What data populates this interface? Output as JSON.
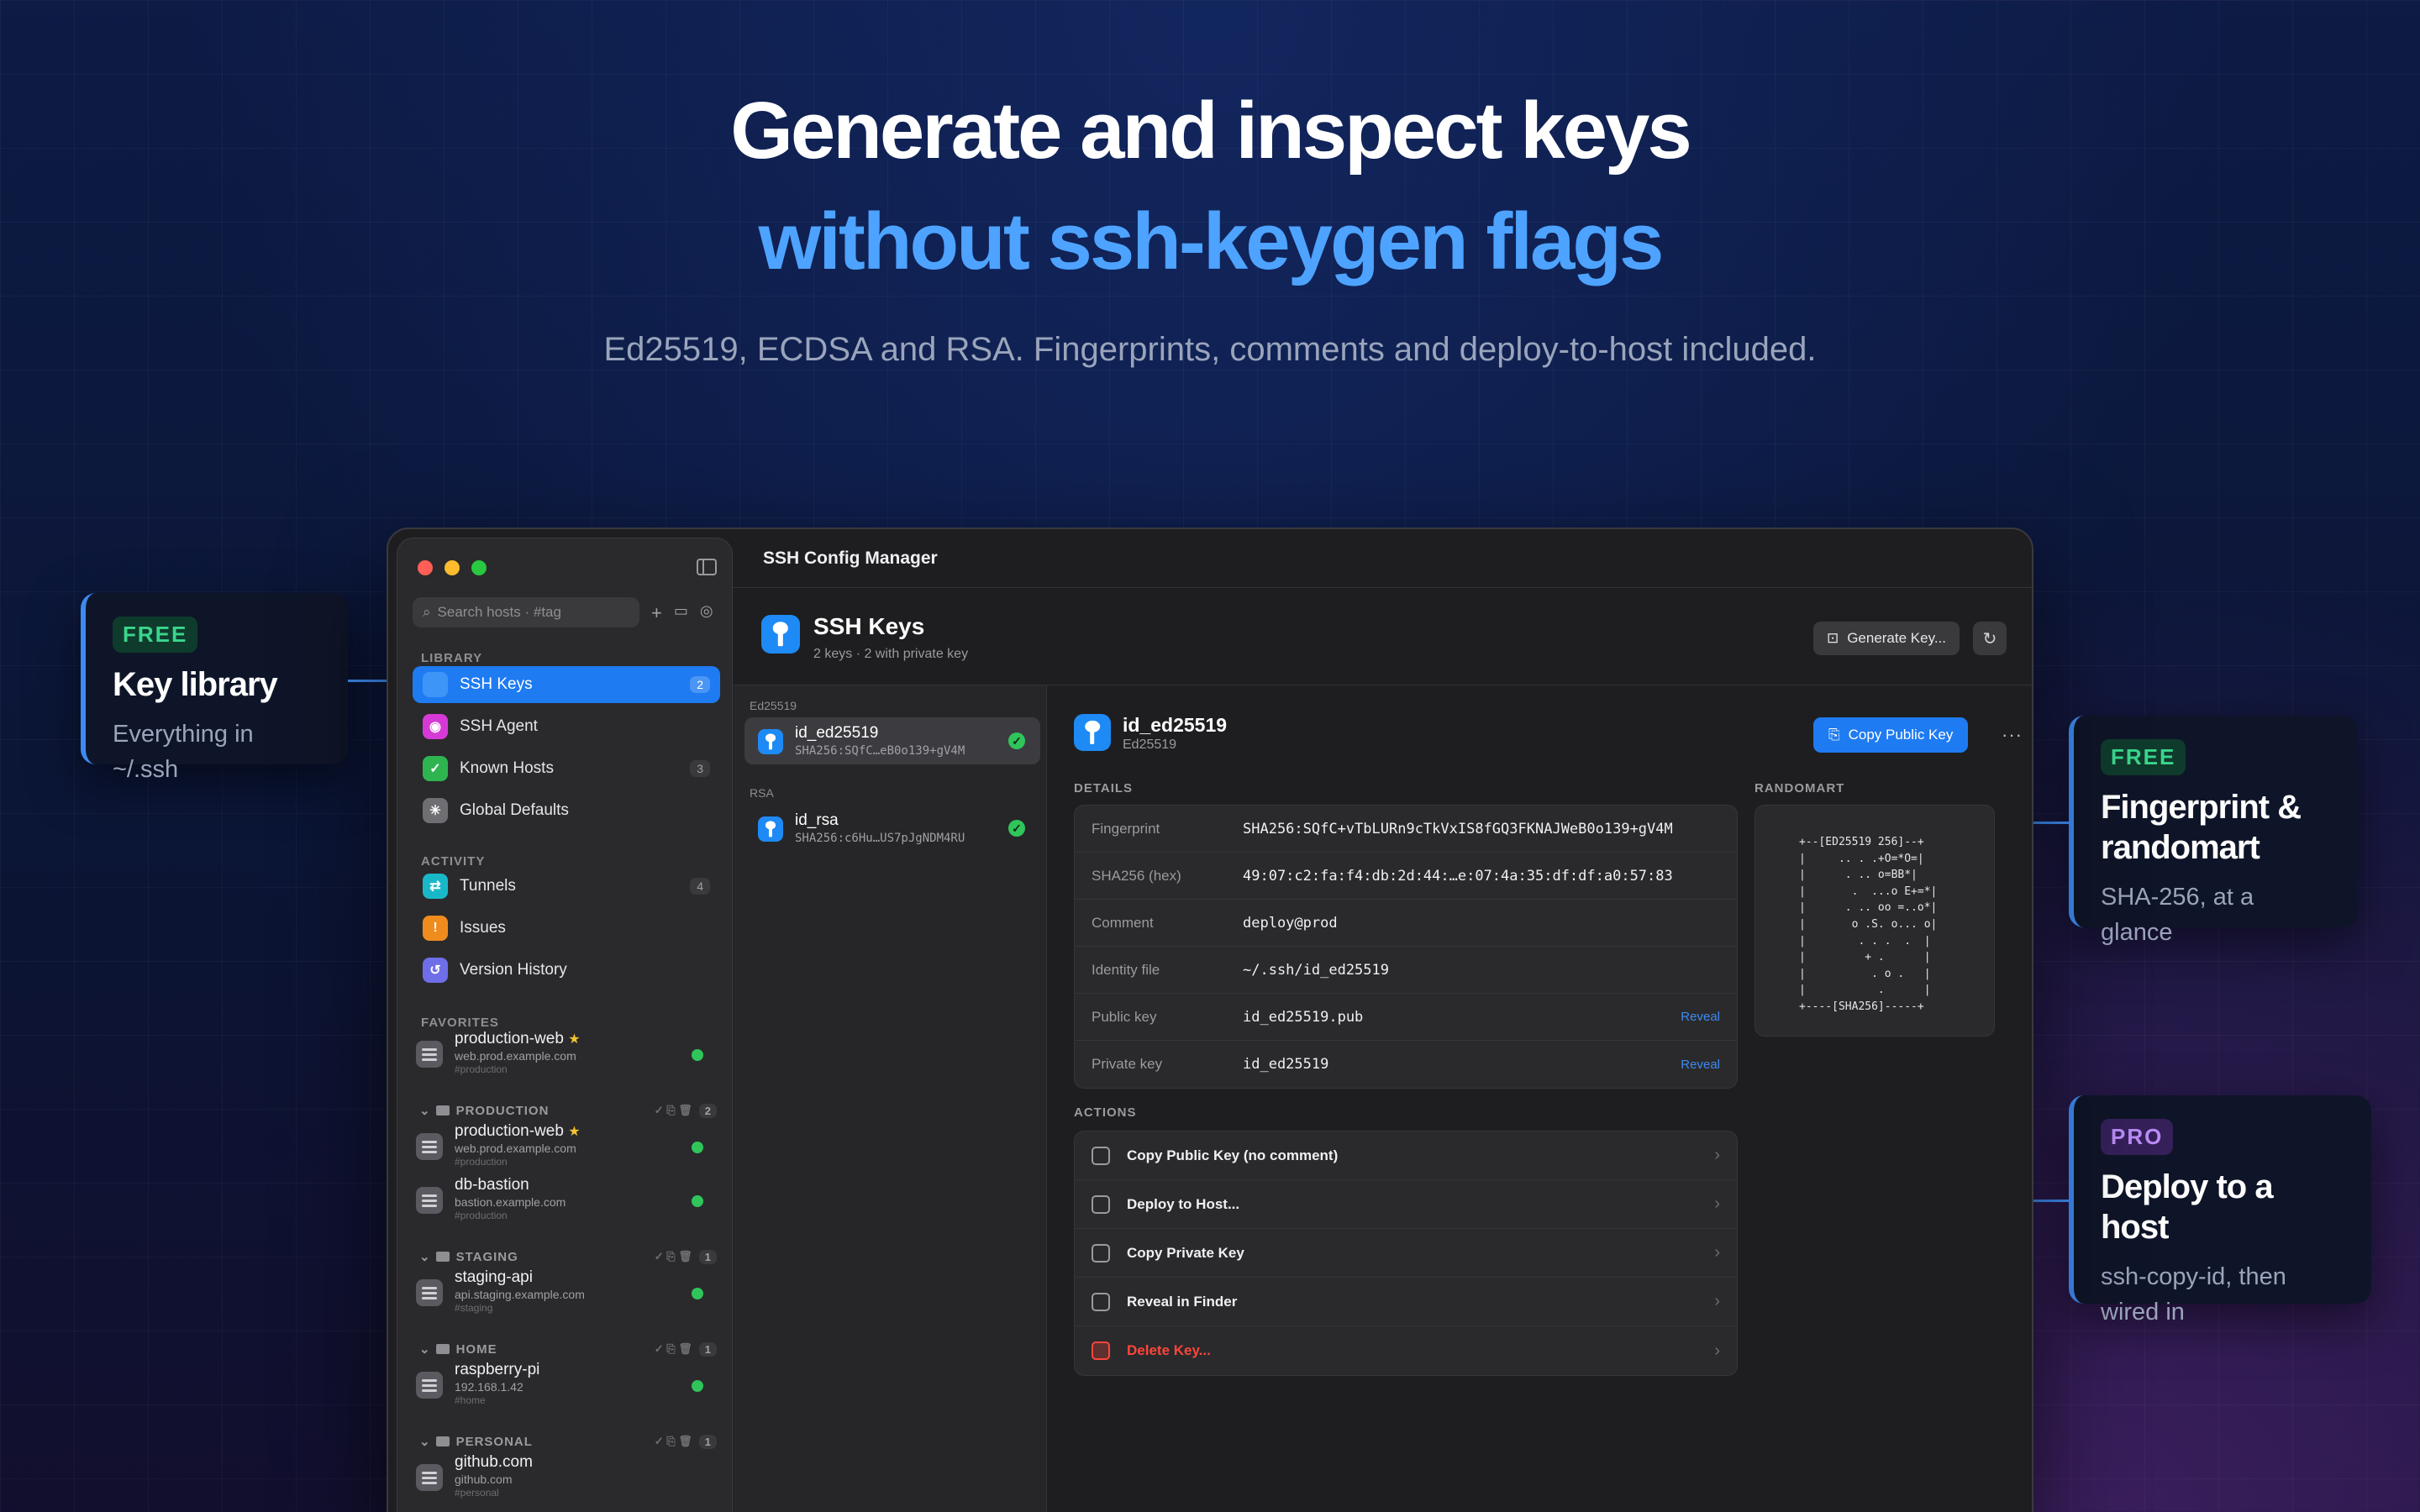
{
  "hero": {
    "title": "Generate and inspect keys",
    "highlight": "without ssh-keygen flags",
    "subtitle": "Ed25519, ECDSA and RSA. Fingerprints, comments and deploy-to-host included."
  },
  "callouts": {
    "left": {
      "badge": "FREE",
      "title": "Key library",
      "subtitle": "Everything in ~/.ssh"
    },
    "right_top": {
      "badge": "FREE",
      "title_line1": "Fingerprint &",
      "title_line2": "randomart",
      "subtitle": "SHA-256, at a glance"
    },
    "right_bottom": {
      "badge": "PRO",
      "title": "Deploy to a host",
      "subtitle_line1": "ssh-copy-id, then",
      "subtitle_line2": "wired in"
    }
  },
  "window": {
    "title": "SSH Config Manager"
  },
  "sidebar": {
    "search_placeholder": "Search hosts · #tag",
    "library_label": "LIBRARY",
    "library": [
      {
        "label": "SSH Keys",
        "count": "2",
        "icon": "key-icon",
        "color": "#1e8af5"
      },
      {
        "label": "SSH Agent",
        "count": "",
        "icon": "agent-icon",
        "color": "#d63ad6"
      },
      {
        "label": "Known Hosts",
        "count": "3",
        "icon": "shield-icon",
        "color": "#2fb550"
      },
      {
        "label": "Global Defaults",
        "count": "",
        "icon": "asterisk-icon",
        "color": "#6e6e73"
      }
    ],
    "activity_label": "ACTIVITY",
    "activity": [
      {
        "label": "Tunnels",
        "count": "4",
        "icon": "tunnel-icon",
        "color": "#19b8c9"
      },
      {
        "label": "Issues",
        "count": "",
        "icon": "warning-icon",
        "color": "#f08c1e"
      },
      {
        "label": "Version History",
        "count": "",
        "icon": "history-icon",
        "color": "#6e6ee8"
      }
    ],
    "favorites_label": "FAVORITES",
    "favorites": [
      {
        "name": "production-web",
        "star": "★",
        "addr": "web.prod.example.com",
        "tag": "#production"
      }
    ],
    "groups": [
      {
        "label": "PRODUCTION",
        "tools": "✓ ⎘ 🗑",
        "count": "2",
        "hosts": [
          {
            "name": "production-web",
            "star": "★",
            "addr": "web.prod.example.com",
            "tag": "#production"
          },
          {
            "name": "db-bastion",
            "star": "",
            "addr": "bastion.example.com",
            "tag": "#production"
          }
        ]
      },
      {
        "label": "STAGING",
        "tools": "✓ ⎘ 🗑",
        "count": "1",
        "hosts": [
          {
            "name": "staging-api",
            "star": "",
            "addr": "api.staging.example.com",
            "tag": "#staging"
          }
        ]
      },
      {
        "label": "HOME",
        "tools": "✓ ⎘ 🗑",
        "count": "1",
        "hosts": [
          {
            "name": "raspberry-pi",
            "star": "",
            "addr": "192.168.1.42",
            "tag": "#home"
          }
        ]
      },
      {
        "label": "PERSONAL",
        "tools": "✓ ⎘ 🗑",
        "count": "1",
        "hosts": [
          {
            "name": "github.com",
            "star": "",
            "addr": "github.com",
            "tag": "#personal"
          }
        ]
      }
    ]
  },
  "page": {
    "title": "SSH Keys",
    "subtitle": "2 keys · 2 with private key",
    "generate_label": "Generate Key...",
    "refresh_icon": "refresh-icon"
  },
  "key_list": {
    "sections": [
      {
        "label": "Ed25519",
        "keys": [
          {
            "name": "id_ed25519",
            "fp": "SHA256:SQfC…eB0o139+gV4M"
          }
        ]
      },
      {
        "label": "RSA",
        "keys": [
          {
            "name": "id_rsa",
            "fp": "SHA256:c6Hu…US7pJgNDM4RU"
          }
        ]
      }
    ]
  },
  "detail": {
    "name": "id_ed25519",
    "type": "Ed25519",
    "copy_label": "Copy Public Key",
    "more": "···",
    "details_label": "DETAILS",
    "rows": [
      {
        "key": "Fingerprint",
        "value": "SHA256:SQfC+vTbLURn9cTkVxIS8fGQ3FKNAJWeB0o139+gV4M",
        "action": ""
      },
      {
        "key": "SHA256 (hex)",
        "value": "49:07:c2:fa:f4:db:2d:44:…e:07:4a:35:df:df:a0:57:83",
        "action": ""
      },
      {
        "key": "Comment",
        "value": "deploy@prod",
        "action": ""
      },
      {
        "key": "Identity file",
        "value": "~/.ssh/id_ed25519",
        "action": ""
      },
      {
        "key": "Public key",
        "value": "id_ed25519.pub",
        "action": "Reveal"
      },
      {
        "key": "Private key",
        "value": "id_ed25519",
        "action": "Reveal"
      }
    ],
    "randomart_label": "RANDOMART",
    "randomart": "+--[ED25519 256]--+\n|     .. . .+O=*O=|\n|      . .. o=BB*|\n|       .  ...o E+=*|\n|      . .. oo =..o*|\n|       o .S. o... o|\n|        . . .  .  |\n|         + .      |\n|          . o .   |\n|           .      |\n+----[SHA256]-----+",
    "actions_label": "ACTIONS",
    "actions": [
      {
        "label": "Copy Public Key (no comment)",
        "icon": "copy-icon",
        "danger": false
      },
      {
        "label": "Deploy to Host...",
        "icon": "share-icon",
        "danger": false
      },
      {
        "label": "Copy Private Key",
        "icon": "copy-icon",
        "danger": false
      },
      {
        "label": "Reveal in Finder",
        "icon": "folder-icon",
        "danger": false
      },
      {
        "label": "Delete Key...",
        "icon": "trash-icon",
        "danger": true
      }
    ]
  }
}
